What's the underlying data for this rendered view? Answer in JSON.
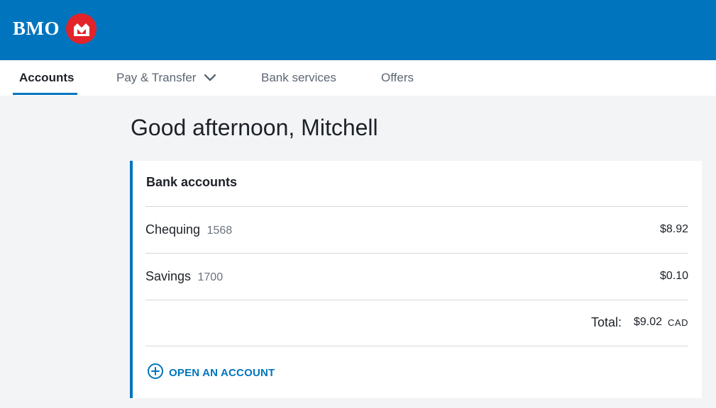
{
  "brand": {
    "name": "BMO",
    "primary_color": "#0075be",
    "roundel_color": "#e3232a",
    "roundel_icon": "bmo-mark-icon"
  },
  "nav": {
    "items": [
      {
        "label": "Accounts",
        "active": true
      },
      {
        "label": "Pay & Transfer",
        "icon": "chevron-down-icon"
      },
      {
        "label": "Bank services"
      },
      {
        "label": "Offers"
      }
    ]
  },
  "greeting": "Good afternoon, Mitchell",
  "bank_accounts": {
    "title": "Bank accounts",
    "accounts": [
      {
        "name": "Chequing",
        "number": "1568",
        "balance": "$8.92"
      },
      {
        "name": "Savings",
        "number": "1700",
        "balance": "$0.10"
      }
    ],
    "total_label": "Total:",
    "total_value": "$9.02",
    "total_currency": "CAD",
    "open_account_label": "OPEN AN ACCOUNT",
    "open_account_icon": "plus-circle-icon"
  }
}
